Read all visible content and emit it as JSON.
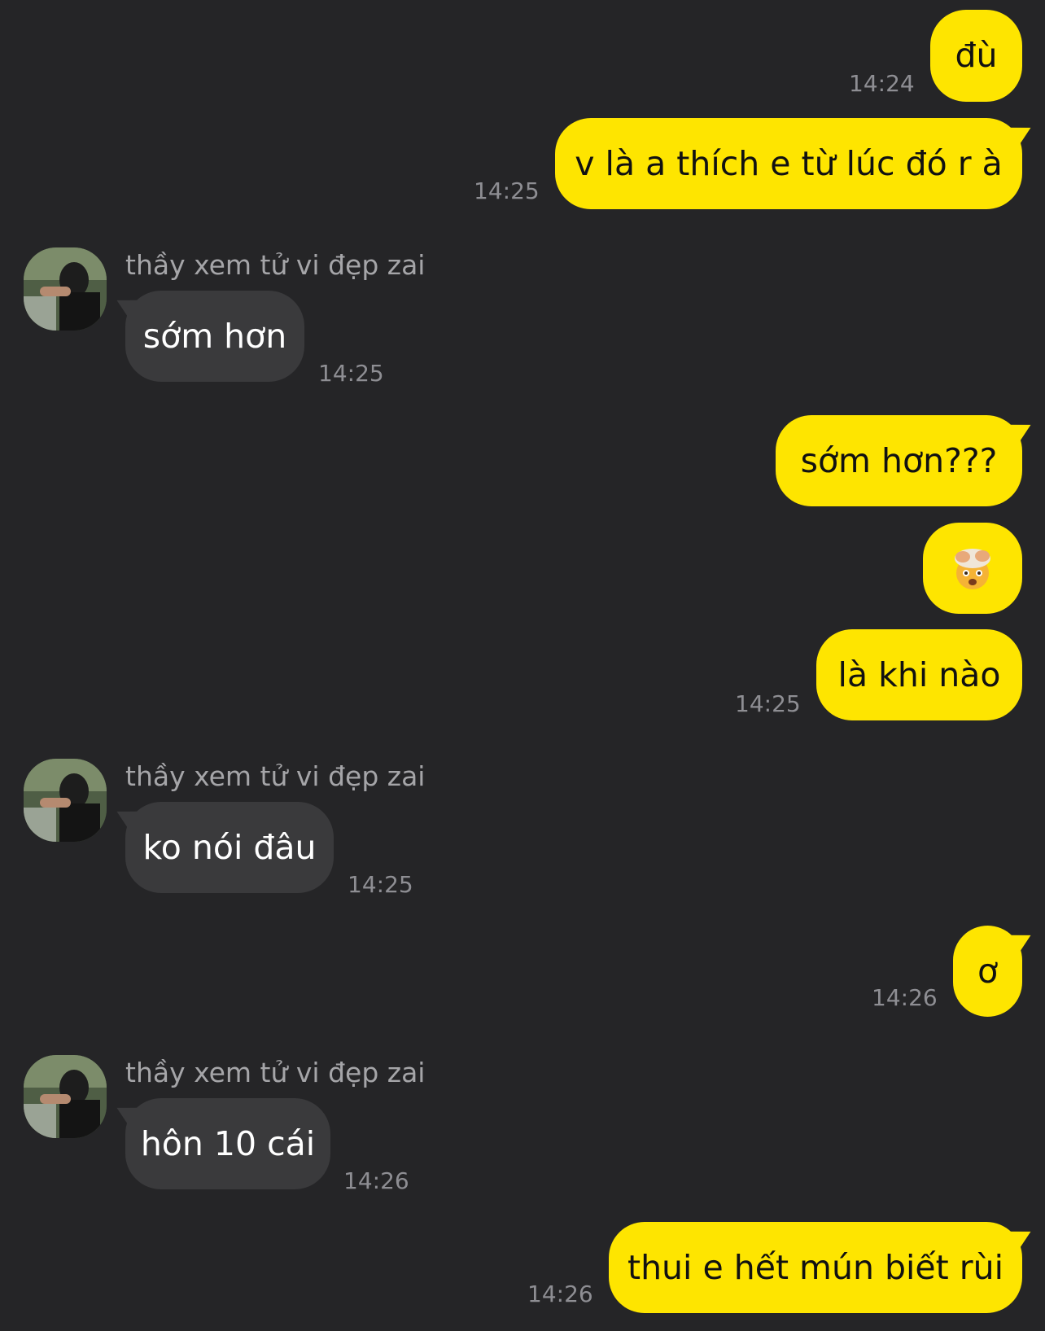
{
  "contact": {
    "name": "thầy xem tử vi đẹp zai"
  },
  "messages": [
    {
      "dir": "out",
      "text": "đù",
      "time": "14:24"
    },
    {
      "dir": "out",
      "text": "v là a thích e từ lúc đó r à",
      "time": "14:25"
    },
    {
      "dir": "in",
      "text": "sớm hơn",
      "time": "14:25"
    },
    {
      "dir": "out",
      "text": "sớm hơn???",
      "time": ""
    },
    {
      "dir": "out",
      "text": "",
      "emoji": "exploding-head-icon",
      "time": ""
    },
    {
      "dir": "out",
      "text": "là khi nào",
      "time": "14:25"
    },
    {
      "dir": "in",
      "text": "ko nói đâu",
      "time": "14:25"
    },
    {
      "dir": "out",
      "text": "ơ",
      "time": "14:26"
    },
    {
      "dir": "in",
      "text": "hôn 10 cái",
      "time": "14:26"
    },
    {
      "dir": "out",
      "text": "thui e hết mún biết rùi",
      "time": "14:26"
    }
  ],
  "colors": {
    "background": "#252527",
    "outgoing_bubble": "#fee500",
    "incoming_bubble": "#3a3a3c",
    "timestamp": "#8e8e93"
  }
}
